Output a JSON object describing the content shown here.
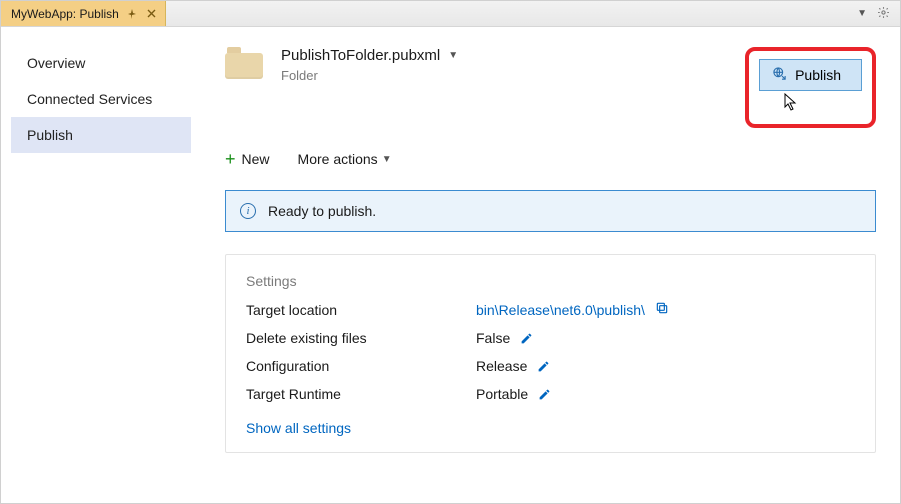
{
  "titlebar": {
    "tab_title": "MyWebApp: Publish"
  },
  "sidebar": {
    "items": [
      {
        "label": "Overview"
      },
      {
        "label": "Connected Services"
      },
      {
        "label": "Publish",
        "active": true
      }
    ]
  },
  "profile": {
    "name": "PublishToFolder.pubxml",
    "type": "Folder"
  },
  "publish_button": "Publish",
  "actions": {
    "new": "New",
    "more": "More actions"
  },
  "banner": {
    "text": "Ready to publish."
  },
  "settings": {
    "title": "Settings",
    "rows": [
      {
        "label": "Target location",
        "value": "bin\\Release\\net6.0\\publish\\",
        "link": true,
        "copy": true
      },
      {
        "label": "Delete existing files",
        "value": "False",
        "edit": true
      },
      {
        "label": "Configuration",
        "value": "Release",
        "edit": true
      },
      {
        "label": "Target Runtime",
        "value": "Portable",
        "edit": true
      }
    ],
    "show_all": "Show all settings"
  }
}
